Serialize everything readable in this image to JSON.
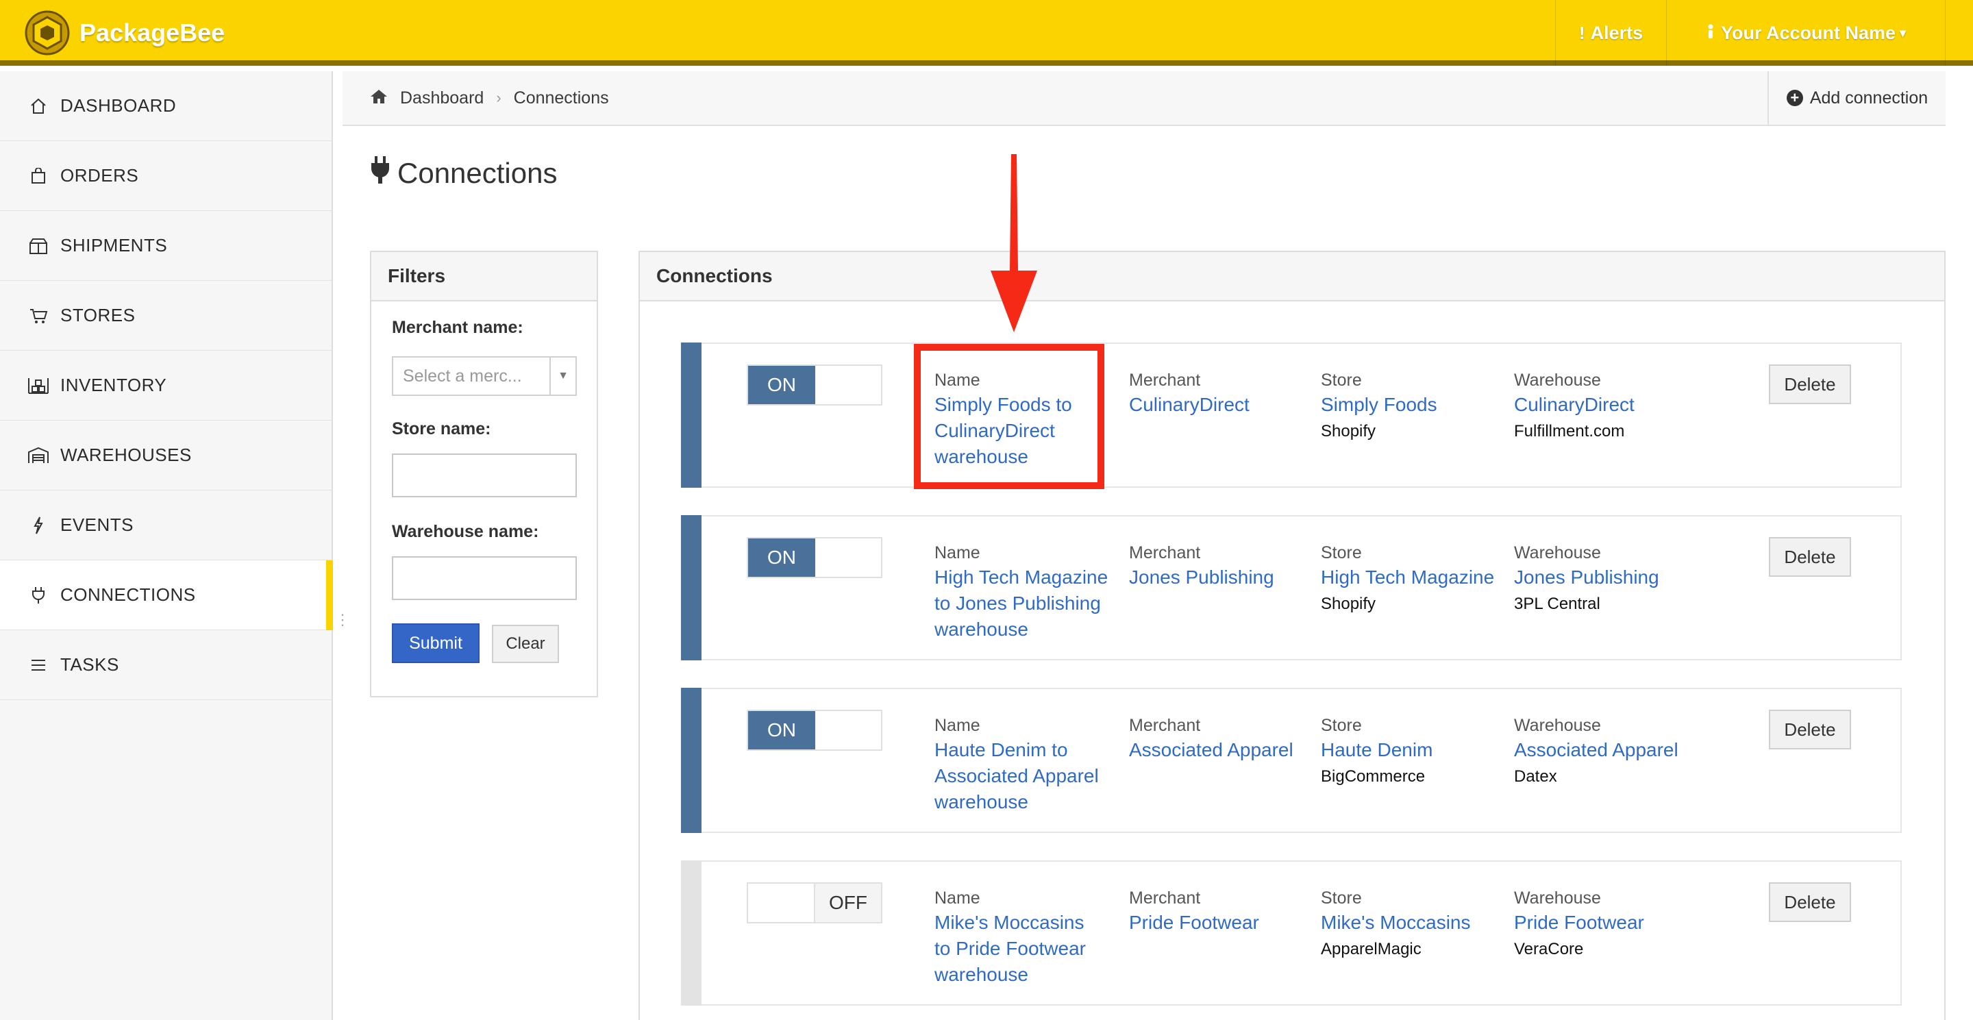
{
  "app": {
    "name": "PackageBee"
  },
  "topbar": {
    "alerts_label": "Alerts",
    "account_label": "Your Account Name"
  },
  "sidebar": {
    "items": [
      {
        "label": "DASHBOARD",
        "icon": "home-icon"
      },
      {
        "label": "ORDERS",
        "icon": "bag-icon"
      },
      {
        "label": "SHIPMENTS",
        "icon": "box-icon"
      },
      {
        "label": "STORES",
        "icon": "cart-icon"
      },
      {
        "label": "INVENTORY",
        "icon": "inventory-icon"
      },
      {
        "label": "WAREHOUSES",
        "icon": "warehouse-icon"
      },
      {
        "label": "EVENTS",
        "icon": "bolt-icon"
      },
      {
        "label": "CONNECTIONS",
        "icon": "plug-icon",
        "active": true
      },
      {
        "label": "TASKS",
        "icon": "list-icon"
      }
    ]
  },
  "breadcrumb": {
    "home": "Dashboard",
    "current": "Connections"
  },
  "actions": {
    "add_connection": "Add connection"
  },
  "page": {
    "title": "Connections"
  },
  "filters": {
    "title": "Filters",
    "merchant_label": "Merchant name:",
    "merchant_placeholder": "Select a merc...",
    "store_label": "Store name:",
    "store_value": "",
    "warehouse_label": "Warehouse name:",
    "warehouse_value": "",
    "submit": "Submit",
    "clear": "Clear"
  },
  "connections": {
    "title": "Connections",
    "labels": {
      "name": "Name",
      "merchant": "Merchant",
      "store": "Store",
      "warehouse": "Warehouse",
      "delete": "Delete"
    },
    "rows": [
      {
        "status": "ON",
        "name": [
          "Simply Foods to",
          "CulinaryDirect",
          "warehouse"
        ],
        "merchant": "CulinaryDirect",
        "store": "Simply Foods",
        "store_platform": "Shopify",
        "warehouse": "CulinaryDirect",
        "warehouse_system": "Fulfillment.com"
      },
      {
        "status": "ON",
        "name": [
          "High Tech Magazine",
          "to Jones Publishing",
          "warehouse"
        ],
        "merchant": "Jones Publishing",
        "store": "High Tech Magazine",
        "store_platform": "Shopify",
        "warehouse": "Jones Publishing",
        "warehouse_system": "3PL Central"
      },
      {
        "status": "ON",
        "name": [
          "Haute Denim to",
          "Associated Apparel",
          "warehouse"
        ],
        "merchant": "Associated Apparel",
        "store": "Haute Denim",
        "store_platform": "BigCommerce",
        "warehouse": "Associated Apparel",
        "warehouse_system": "Datex"
      },
      {
        "status": "OFF",
        "name": [
          "Mike's Moccasins",
          "to Pride Footwear",
          "warehouse"
        ],
        "merchant": "Pride Footwear",
        "store": "Mike's Moccasins",
        "store_platform": "ApparelMagic",
        "warehouse": "Pride Footwear",
        "warehouse_system": "VeraCore"
      }
    ]
  },
  "colors": {
    "brand_yellow": "#fbd400",
    "toggle_on": "#4a719a",
    "link": "#2f6bc4",
    "annotation": "#f42a16",
    "submit": "#3466c8"
  }
}
